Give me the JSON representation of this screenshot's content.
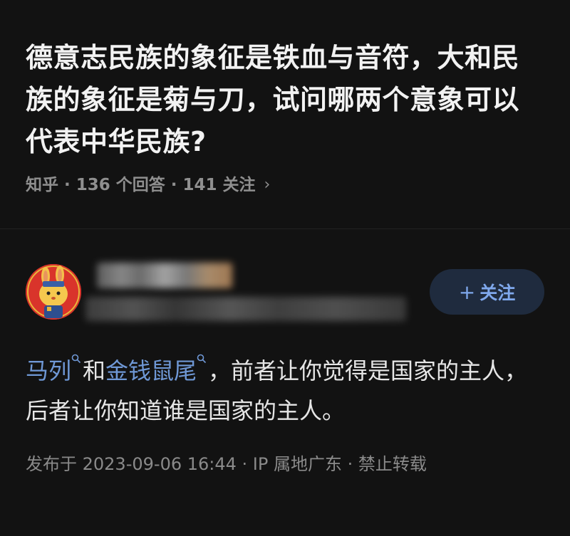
{
  "question": {
    "title": "德意志民族的象征是铁血与音符，大和民族的象征是菊与刀，试问哪两个意象可以代表中华民族?",
    "meta": "知乎 · 136 个回答 · 141 关注",
    "chevron": "›"
  },
  "author": {
    "follow_label": "关注",
    "follow_plus": "+"
  },
  "answer": {
    "link1": "马列",
    "connector": "和",
    "link2": "金钱鼠尾",
    "text": "，前者让你觉得是国家的主人，后者让你知道谁是国家的主人。"
  },
  "publish": {
    "info": "发布于 2023-09-06 16:44 · IP 属地广东 · 禁止转载"
  },
  "colors": {
    "background": "#121212",
    "link": "#6f98d6",
    "follow_bg": "#1f2b3e",
    "follow_text": "#7fa8ec",
    "meta": "#8f8f8f"
  }
}
